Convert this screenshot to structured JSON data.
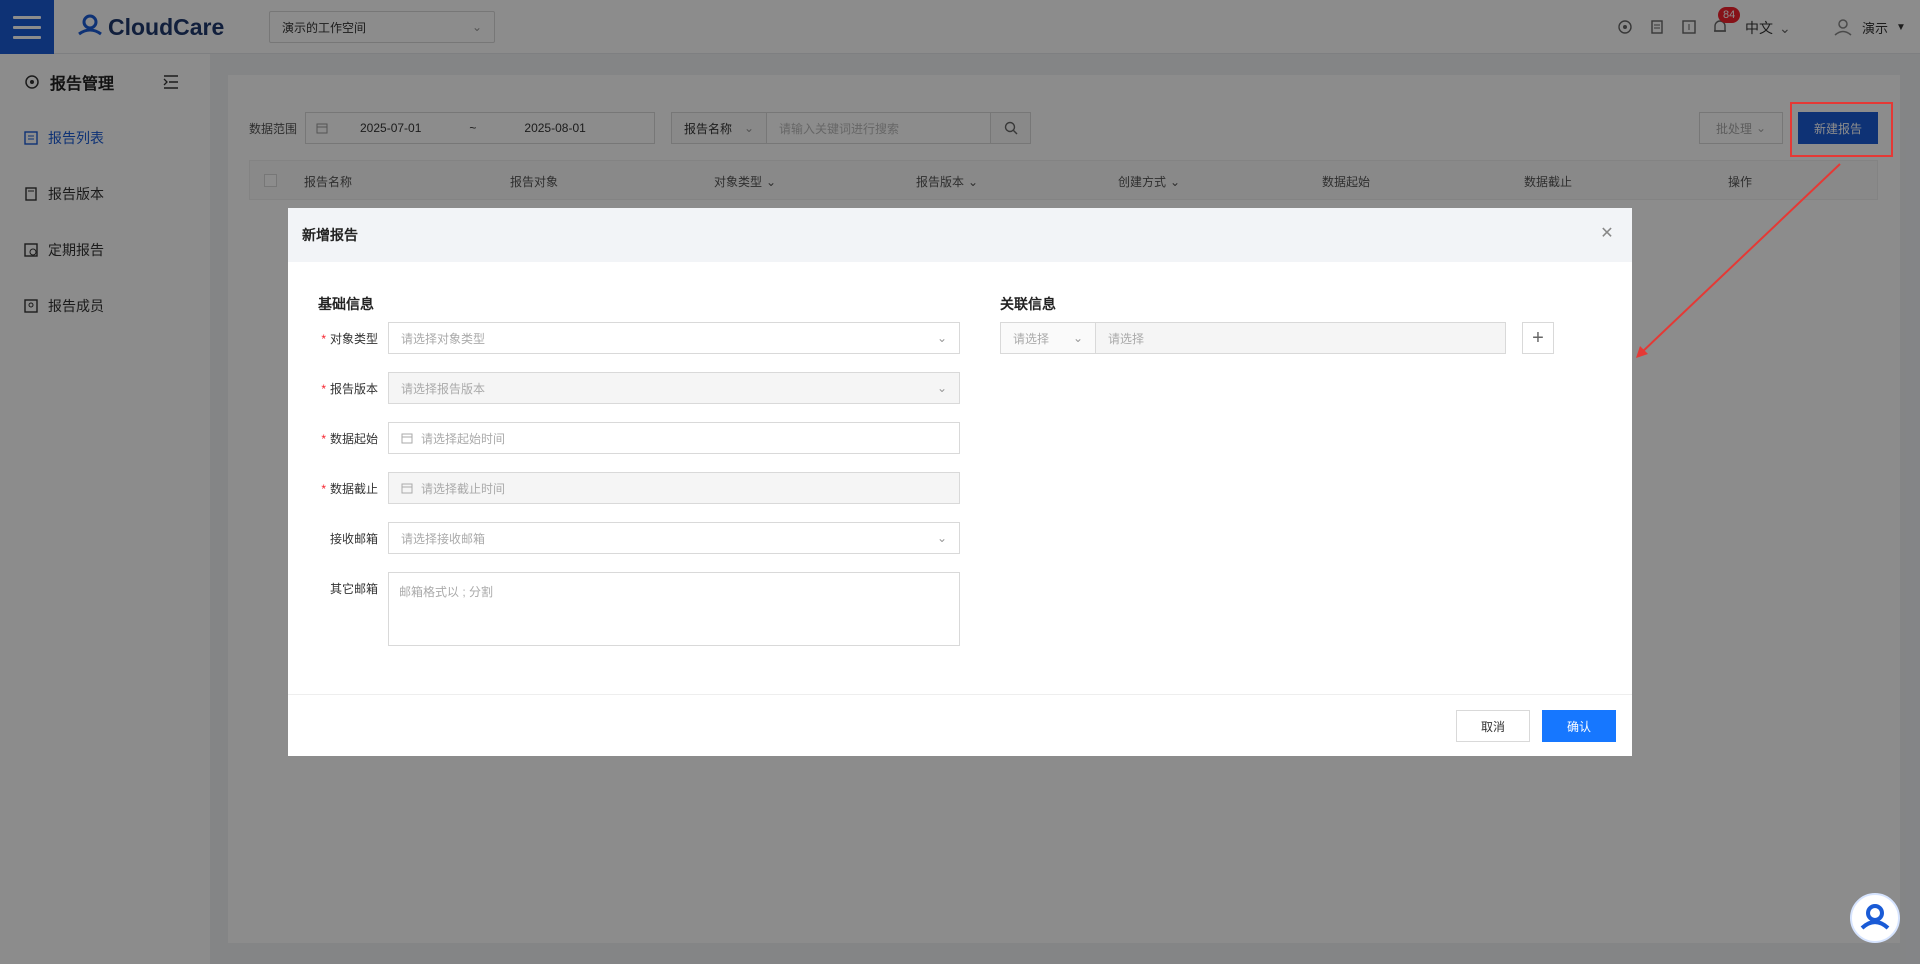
{
  "topbar": {
    "logo_text": "CloudCare",
    "workspace": "演示的工作空间",
    "notification_count": "84",
    "language": "中文",
    "user_name": "演示"
  },
  "sidebar": {
    "title": "报告管理",
    "items": [
      {
        "label": "报告列表",
        "icon": "list-icon",
        "active": true
      },
      {
        "label": "报告版本",
        "icon": "version-icon",
        "active": false
      },
      {
        "label": "定期报告",
        "icon": "schedule-icon",
        "active": false
      },
      {
        "label": "报告成员",
        "icon": "member-icon",
        "active": false
      }
    ]
  },
  "filters": {
    "range_label": "数据范围",
    "start_date": "2025-07-01",
    "separator": "~",
    "end_date": "2025-08-01",
    "search_field": "报告名称",
    "search_placeholder": "请输入关键词进行搜索",
    "batch_label": "批处理",
    "new_report_label": "新建报告"
  },
  "table": {
    "columns": [
      "报告名称",
      "报告对象",
      "对象类型",
      "报告版本",
      "创建方式",
      "数据起始",
      "数据截止",
      "操作"
    ]
  },
  "modal": {
    "title": "新增报告",
    "basic_section": "基础信息",
    "related_section": "关联信息",
    "fields": {
      "object_type": {
        "label": "对象类型",
        "placeholder": "请选择对象类型"
      },
      "report_version": {
        "label": "报告版本",
        "placeholder": "请选择报告版本"
      },
      "data_start": {
        "label": "数据起始",
        "placeholder": "请选择起始时间"
      },
      "data_end": {
        "label": "数据截止",
        "placeholder": "请选择截止时间"
      },
      "receive_email": {
        "label": "接收邮箱",
        "placeholder": "请选择接收邮箱"
      },
      "other_email": {
        "label": "其它邮箱",
        "placeholder": "邮箱格式以 ; 分割"
      }
    },
    "related": {
      "select_placeholder": "请选择",
      "input_placeholder": "请选择"
    },
    "cancel_label": "取消",
    "confirm_label": "确认"
  },
  "colors": {
    "primary": "#1a5bd6",
    "confirm": "#1677ff",
    "highlight": "#e53935"
  }
}
